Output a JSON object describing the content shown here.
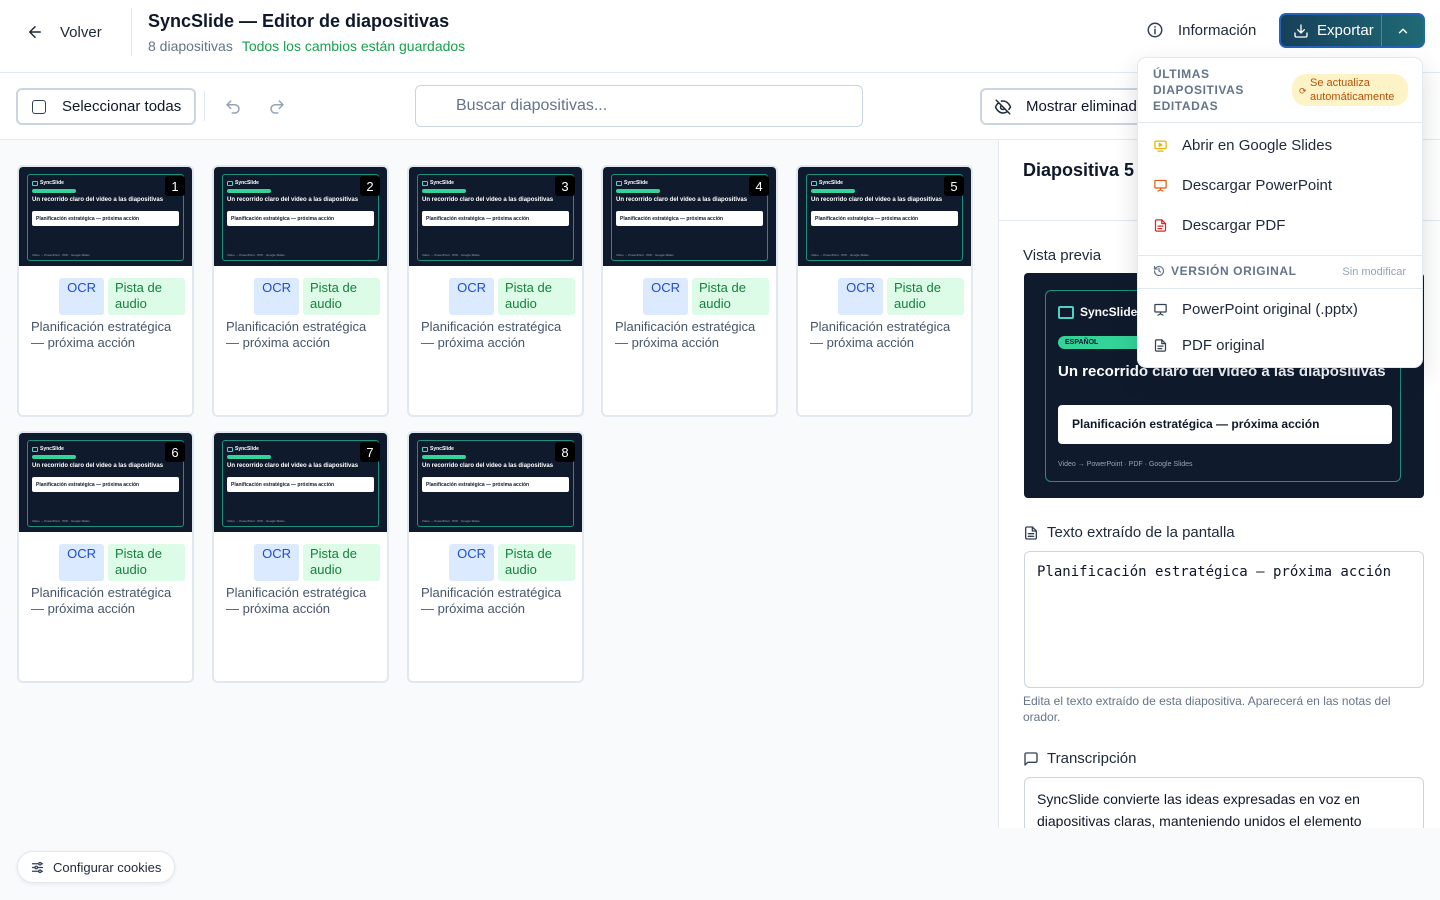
{
  "header": {
    "back_label": "Volver",
    "title": "SyncSlide — Editor de diapositivas",
    "slide_count": "8 diapositivas",
    "save_status": "Todos los cambios están guardados",
    "info_label": "Información",
    "export_label": "Exportar"
  },
  "toolbar": {
    "select_all_label": "Seleccionar todas",
    "search_placeholder": "Buscar diapositivas...",
    "show_deleted_label": "Mostrar eliminadas"
  },
  "slides": [
    {
      "number": "1",
      "ocr_tag": "OCR",
      "audio_tag": "Pista de audio",
      "title": "Planificación estratégica — próxima acción"
    },
    {
      "number": "2",
      "ocr_tag": "OCR",
      "audio_tag": "Pista de audio",
      "title": "Planificación estratégica — próxima acción"
    },
    {
      "number": "3",
      "ocr_tag": "OCR",
      "audio_tag": "Pista de audio",
      "title": "Planificación estratégica — próxima acción"
    },
    {
      "number": "4",
      "ocr_tag": "OCR",
      "audio_tag": "Pista de audio",
      "title": "Planificación estratégica — próxima acción"
    },
    {
      "number": "5",
      "ocr_tag": "OCR",
      "audio_tag": "Pista de audio",
      "title": "Planificación estratégica — próxima acción"
    },
    {
      "number": "6",
      "ocr_tag": "OCR",
      "audio_tag": "Pista de audio",
      "title": "Planificación estratégica — próxima acción"
    },
    {
      "number": "7",
      "ocr_tag": "OCR",
      "audio_tag": "Pista de audio",
      "title": "Planificación estratégica — próxima acción"
    },
    {
      "number": "8",
      "ocr_tag": "OCR",
      "audio_tag": "Pista de audio",
      "title": "Planificación estratégica — próxima acción"
    }
  ],
  "thumbnail": {
    "brand": "SyncSlide",
    "language": "ESPAÑOL",
    "heading": "Un recorrido claro del video a las diapositivas",
    "box_text": "Planificación estratégica — próxima acción",
    "footer": "Video → PowerPoint · PDF · Google Slides"
  },
  "panel": {
    "title": "Diapositiva 5",
    "preview_label": "Vista previa",
    "ocr_label": "Texto extraído de la pantalla",
    "ocr_text": "Planificación estratégica — próxima acción",
    "ocr_help": "Edita el texto extraído de esta diapositiva. Aparecerá en las notas del orador.",
    "transcript_label": "Transcripción",
    "transcript_text": "SyncSlide convierte las ideas expresadas en voz en diapositivas claras, manteniendo unidos el elemento"
  },
  "export_menu": {
    "recent_header": "Últimas diapositivas editadas",
    "auto_update_badge": "Se actualiza automáticamente",
    "items": [
      {
        "label": "Abrir en Google Slides",
        "icon": "google-slides-icon"
      },
      {
        "label": "Descargar PowerPoint",
        "icon": "powerpoint-icon"
      },
      {
        "label": "Descargar PDF",
        "icon": "pdf-icon"
      }
    ],
    "original_header": "Versión original",
    "unmodified_label": "Sin modificar",
    "original_items": [
      {
        "label": "PowerPoint original (.pptx)",
        "icon": "presentation-icon"
      },
      {
        "label": "PDF original",
        "icon": "document-icon"
      }
    ]
  },
  "cookie_label": "Configurar cookies",
  "colors": {
    "accent_green": "#16a34a",
    "export_gradient_start": "#17405a",
    "export_gradient_end": "#1f6a75",
    "ocr_tag_bg": "#dbeafe",
    "audio_tag_bg": "#dcfce7",
    "slide_bg": "#0f1b2d"
  }
}
